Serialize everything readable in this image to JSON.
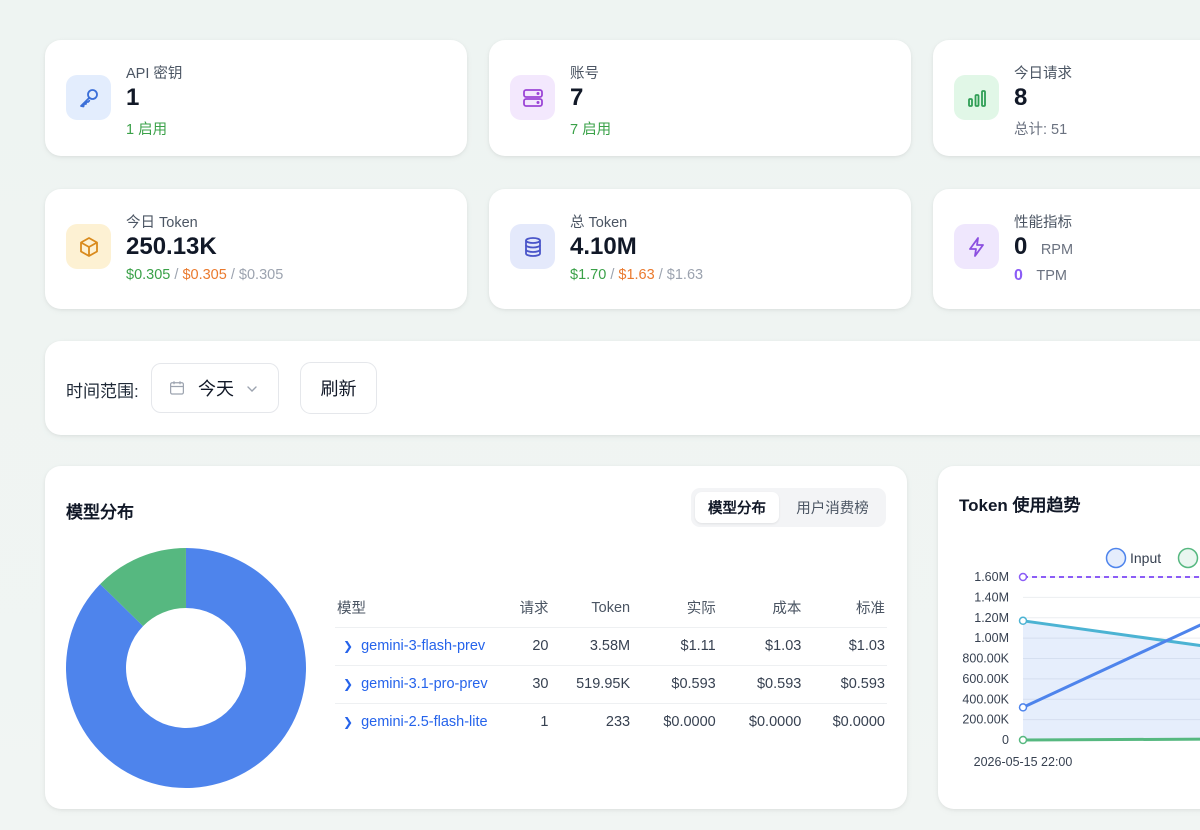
{
  "stats": [
    {
      "title": "API 密钥",
      "value": "1",
      "sub": "1 启用"
    },
    {
      "title": "账号",
      "value": "7",
      "sub": "7 启用"
    },
    {
      "title": "今日请求",
      "value": "8",
      "sub": "总计: 51"
    },
    {
      "title": "今日 Token",
      "value": "250.13K",
      "actual": "$0.305",
      "cost": "$0.305",
      "standard": "$0.305"
    },
    {
      "title": "总 Token",
      "value": "4.10M",
      "actual": "$1.70",
      "cost": "$1.63",
      "standard": "$1.63"
    },
    {
      "title": "性能指标",
      "rpm_value": "0",
      "rpm_label": "RPM",
      "tpm_value": "0",
      "tpm_label": "TPM"
    }
  ],
  "filter": {
    "label": "时间范围:",
    "range": "今天",
    "refresh": "刷新"
  },
  "model_panel": {
    "title": "模型分布",
    "tabs": [
      "模型分布",
      "用户消费榜"
    ],
    "active_tab": 0,
    "columns": [
      "模型",
      "请求",
      "Token",
      "实际",
      "成本",
      "标准"
    ],
    "rows": [
      {
        "model": "gemini-3-flash-prev",
        "requests": "20",
        "tokens": "3.58M",
        "actual": "$1.11",
        "cost": "$1.03",
        "standard": "$1.03"
      },
      {
        "model": "gemini-3.1-pro-prev",
        "requests": "30",
        "tokens": "519.95K",
        "actual": "$0.593",
        "cost": "$0.593",
        "standard": "$0.593"
      },
      {
        "model": "gemini-2.5-flash-lite",
        "requests": "1",
        "tokens": "233",
        "actual": "$0.0000",
        "cost": "$0.0000",
        "standard": "$0.0000"
      }
    ]
  },
  "colors": {
    "blue": "#4e84ec",
    "green": "#56b880",
    "teal": "#4cb3d3",
    "purple": "#8b5cf6"
  },
  "chart_data": [
    {
      "type": "pie",
      "categories": [
        "gemini-3-flash-prev",
        "gemini-3.1-pro-prev",
        "gemini-2.5-flash-lite"
      ],
      "values": [
        3580000,
        519950,
        233
      ],
      "colors": [
        "#4e84ec",
        "#56b880",
        "#e0a030"
      ]
    },
    {
      "type": "line",
      "title": "Token 使用趋势",
      "x": [
        "2026-05-15 22:00"
      ],
      "yticks": [
        "0",
        "200.00K",
        "400.00K",
        "600.00K",
        "800.00K",
        "1.00M",
        "1.20M",
        "1.40M",
        "1.60M"
      ],
      "ylim": [
        0,
        1600000
      ],
      "series": [
        {
          "name": "Input",
          "color": "#4e84ec",
          "values": [
            320000
          ]
        },
        {
          "name": "",
          "color": "#56b880",
          "values": [
            0
          ]
        },
        {
          "name": "",
          "color": "#4cb3d3",
          "values": [
            1170000
          ]
        },
        {
          "name": "",
          "color": "#8b5cf6",
          "values": [
            1600000
          ]
        }
      ],
      "legend": "top"
    }
  ]
}
